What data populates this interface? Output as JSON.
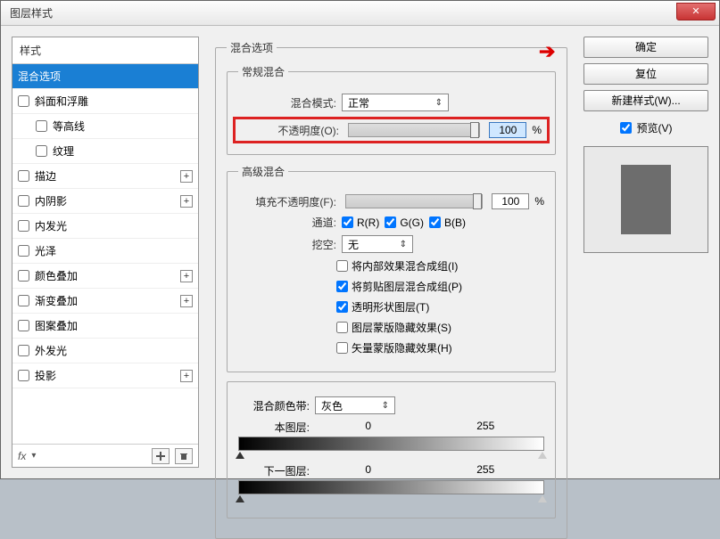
{
  "window": {
    "title": "图层样式"
  },
  "styles": {
    "header": "样式",
    "items": [
      {
        "label": "混合选项",
        "selected": true,
        "checkable": false
      },
      {
        "label": "斜面和浮雕",
        "checkable": true
      },
      {
        "label": "等高线",
        "checkable": true,
        "indent": true
      },
      {
        "label": "纹理",
        "checkable": true,
        "indent": true
      },
      {
        "label": "描边",
        "checkable": true,
        "plus": true
      },
      {
        "label": "内阴影",
        "checkable": true,
        "plus": true
      },
      {
        "label": "内发光",
        "checkable": true
      },
      {
        "label": "光泽",
        "checkable": true
      },
      {
        "label": "颜色叠加",
        "checkable": true,
        "plus": true
      },
      {
        "label": "渐变叠加",
        "checkable": true,
        "plus": true
      },
      {
        "label": "图案叠加",
        "checkable": true
      },
      {
        "label": "外发光",
        "checkable": true
      },
      {
        "label": "投影",
        "checkable": true,
        "plus": true
      }
    ],
    "footer_fx": "fx"
  },
  "options": {
    "group_title": "混合选项",
    "general": {
      "legend": "常规混合",
      "mode_label": "混合模式:",
      "mode_value": "正常",
      "opacity_label": "不透明度(O):",
      "opacity_value": "100",
      "opacity_unit": "%"
    },
    "advanced": {
      "legend": "高级混合",
      "fill_label": "填充不透明度(F):",
      "fill_value": "100",
      "fill_unit": "%",
      "channel_label": "通道:",
      "ch_r": "R(R)",
      "ch_g": "G(G)",
      "ch_b": "B(B)",
      "knockout_label": "挖空:",
      "knockout_value": "无",
      "opts": {
        "inner_group": "将内部效果混合成组(I)",
        "clip_group": "将剪贴图层混合成组(P)",
        "trans_shape": "透明形状图层(T)",
        "mask_hide": "图层蒙版隐藏效果(S)",
        "vmask_hide": "矢量蒙版隐藏效果(H)"
      }
    },
    "blendif": {
      "legend_label": "混合颜色带:",
      "legend_value": "灰色",
      "this_label": "本图层:",
      "this_low": "0",
      "this_high": "255",
      "under_label": "下一图层:",
      "under_low": "0",
      "under_high": "255"
    }
  },
  "right": {
    "ok": "确定",
    "cancel": "复位",
    "new_style": "新建样式(W)...",
    "preview_label": "预览(V)"
  }
}
